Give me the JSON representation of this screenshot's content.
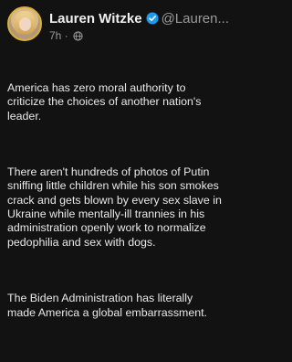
{
  "header": {
    "name": "Lauren Witzke",
    "handle": "@Lauren...",
    "time": "7h",
    "separator": "·"
  },
  "icons": {
    "verified": "verified-badge-icon",
    "audience": "globe-icon"
  },
  "colors": {
    "verified": "#1d9bf0",
    "background": "#121212"
  },
  "post": {
    "paragraphs": [
      "America has zero moral authority to criticize the choices of another nation's leader.",
      "There aren't hundreds of photos of Putin sniffing little children while his son smokes crack and gets blown by every sex slave in Ukraine while mentally-ill trannies in his administration openly work to normalize pedophilia and sex with dogs.",
      "The Biden Administration has literally made America a global embarrassment."
    ]
  }
}
